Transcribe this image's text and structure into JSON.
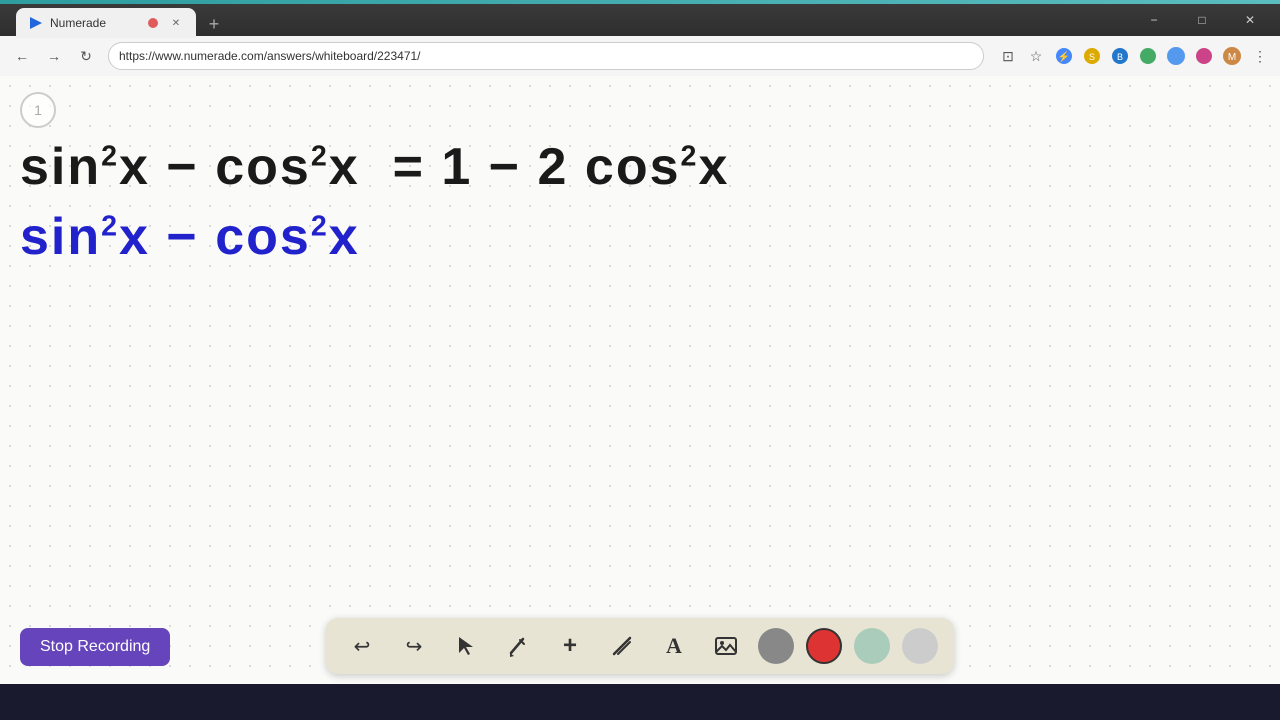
{
  "browser": {
    "tab_title": "Numerade",
    "url": "https://www.numerade.com/answers/whiteboard/223471/",
    "new_tab_icon": "+",
    "nav": {
      "back_icon": "←",
      "forward_icon": "→",
      "reload_icon": "↻"
    },
    "window_controls": {
      "minimize": "−",
      "maximize": "□",
      "close": "✕"
    }
  },
  "whiteboard": {
    "page_number": "1",
    "line1": {
      "text": "sin²x – cos²x = 1 – 2 cos²x"
    },
    "line2": {
      "text": "sin²x – cos²x"
    }
  },
  "toolbar": {
    "undo_label": "↩",
    "redo_label": "↪",
    "select_label": "▲",
    "pen_label": "✏",
    "plus_label": "+",
    "eraser_label": "/",
    "text_label": "A",
    "image_label": "🖼",
    "color_dark": "#888888",
    "color_red": "#dd3333",
    "color_green": "#99ccaa",
    "color_light": "#cccccc"
  },
  "stop_recording": {
    "label": "Stop Recording"
  }
}
